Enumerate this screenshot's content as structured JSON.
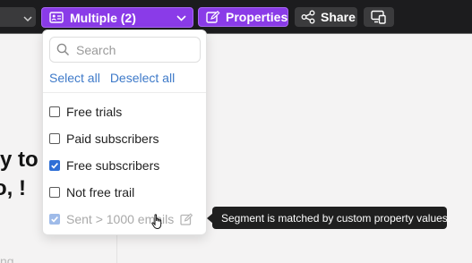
{
  "toolbar": {
    "segment_label": "Multiple (2)",
    "properties_label": "Properties",
    "share_label": "Share",
    "accent": "#8a3be8"
  },
  "dropdown": {
    "search_placeholder": "Search",
    "select_all": "Select all",
    "deselect_all": "Deselect all",
    "options": [
      {
        "label": "Free trials",
        "checked": false
      },
      {
        "label": "Paid subscribers",
        "checked": false
      },
      {
        "label": "Free subscribers",
        "checked": true
      },
      {
        "label": "Not free trail",
        "checked": false
      },
      {
        "label": "Sent > 1000 emails",
        "checked": true,
        "disabled": true
      }
    ]
  },
  "background": {
    "heading_line1": "y to",
    "heading_line2": "o, !",
    "faded_text": "ng"
  },
  "tooltip": {
    "text": "Segment is matched by custom property values."
  },
  "icons": [
    "chevron-down-icon",
    "id-card-icon",
    "edit-icon",
    "share-icon",
    "device-icon",
    "search-icon",
    "pencil-edit-icon",
    "cursor-hand-icon"
  ]
}
